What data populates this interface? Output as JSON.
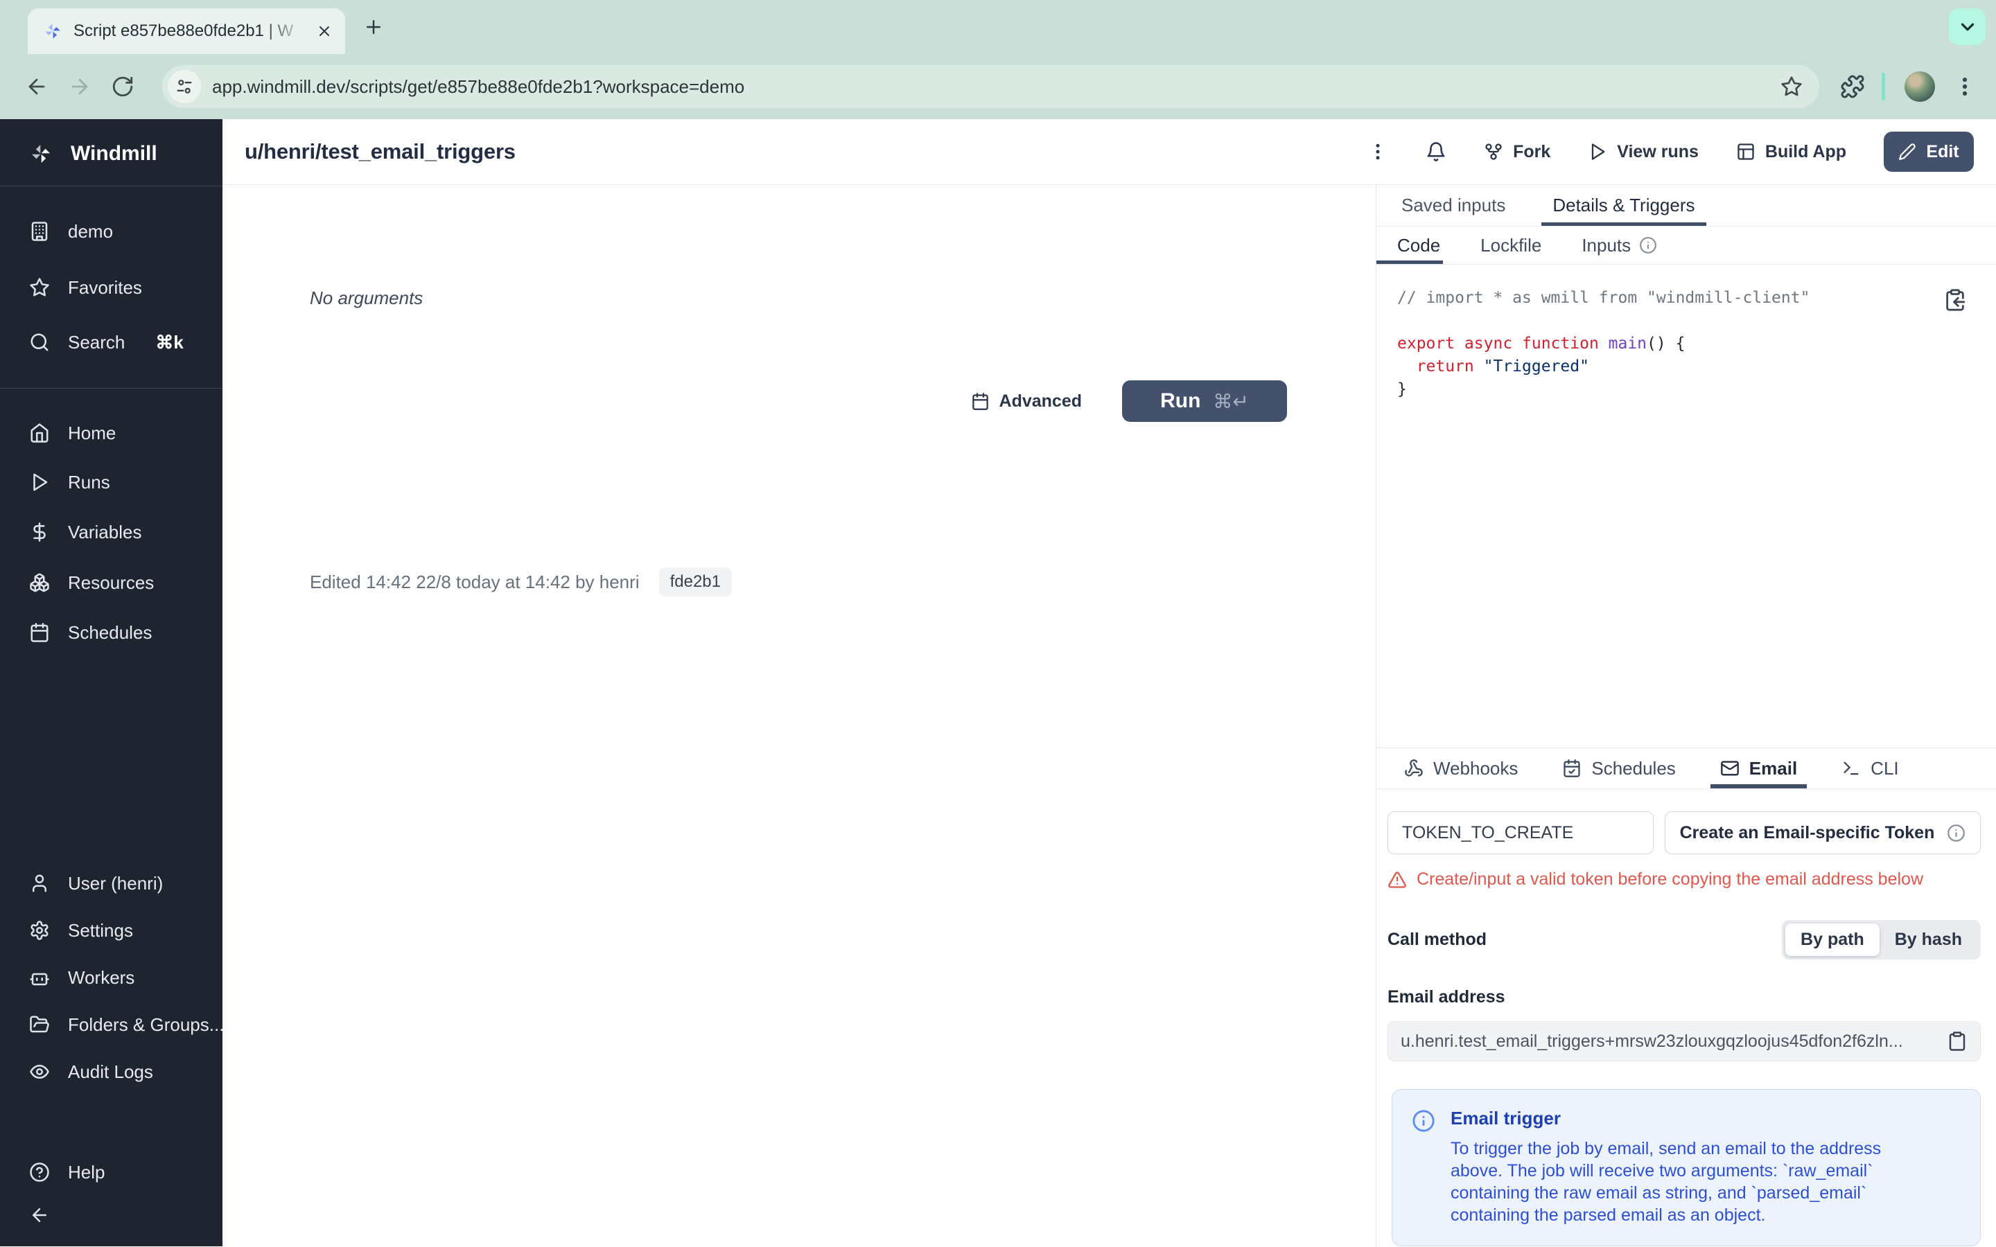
{
  "browser": {
    "tab_title": "Script e857be88e0fde2b1 | W",
    "url": "app.windmill.dev/scripts/get/e857be88e0fde2b1?workspace=demo"
  },
  "sidebar": {
    "brand": "Windmill",
    "workspace": "demo",
    "favorites": "Favorites",
    "search": "Search",
    "search_shortcut": "⌘k",
    "nav": [
      {
        "label": "Home"
      },
      {
        "label": "Runs"
      },
      {
        "label": "Variables"
      },
      {
        "label": "Resources"
      },
      {
        "label": "Schedules"
      }
    ],
    "admin": [
      {
        "label": "User (henri)"
      },
      {
        "label": "Settings"
      },
      {
        "label": "Workers"
      },
      {
        "label": "Folders & Groups..."
      },
      {
        "label": "Audit Logs"
      }
    ],
    "help": "Help"
  },
  "header": {
    "title": "u/henri/test_email_triggers",
    "fork_label": "Fork",
    "view_runs_label": "View runs",
    "build_app_label": "Build App",
    "edit_label": "Edit"
  },
  "main": {
    "no_arguments": "No arguments",
    "advanced_label": "Advanced",
    "run_label": "Run",
    "run_shortcut": "⌘↵",
    "edited_text": "Edited 14:42 22/8 today at 14:42 by henri",
    "version_hash": "fde2b1"
  },
  "panel": {
    "tab_saved_inputs": "Saved inputs",
    "tab_details_triggers": "Details & Triggers",
    "subtab_code": "Code",
    "subtab_lockfile": "Lockfile",
    "subtab_inputs": "Inputs",
    "code": {
      "comment": "// import * as wmill from \"windmill-client\"",
      "kw_export": "export async function ",
      "fn_main": "main",
      "sig_rest": "() {",
      "kw_return": "  return ",
      "str_triggered": "\"Triggered\"",
      "close_brace": "}"
    },
    "trigger_tabs": {
      "webhooks": "Webhooks",
      "schedules": "Schedules",
      "email": "Email",
      "cli": "CLI"
    },
    "email": {
      "token_value": "TOKEN_TO_CREATE",
      "create_button": "Create an Email-specific Token",
      "warning": "Create/input a valid token before copying the email address below",
      "call_method_label": "Call method",
      "by_path": "By path",
      "by_hash": "By hash",
      "address_label": "Email address",
      "address_value": "u.henri.test_email_triggers+mrsw23zlouxgqzloojus45dfon2f6zln...",
      "info_title": "Email trigger",
      "info_body": "To trigger the job by email, send an email to the address above. The job will receive two arguments: `raw_email` containing the raw email as string, and `parsed_email` containing the parsed email as an object."
    }
  },
  "colors": {
    "primary_button": "#44516d",
    "active_underline": "#3f4d66",
    "warning_red": "#e1574c",
    "info_blue": "#2c4fd3",
    "sidebar_bg": "#1f2530",
    "chrome_bg": "#cbdfd9",
    "accent_mint": "#b6f7e4"
  }
}
